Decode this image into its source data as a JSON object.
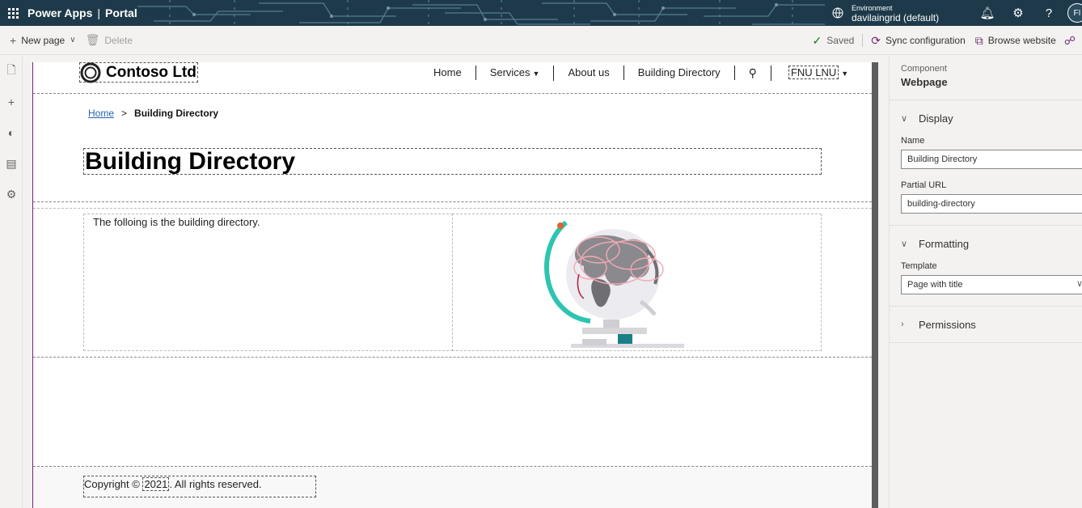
{
  "topbar": {
    "app_name": "Power Apps",
    "separator": "|",
    "section": "Portal",
    "environment_label": "Environment",
    "environment_name": "davilaingrid (default)",
    "avatar_initials": "FI"
  },
  "commandbar": {
    "new_page": "New page",
    "delete": "Delete",
    "saved": "Saved",
    "sync": "Sync configuration",
    "browse": "Browse website"
  },
  "site": {
    "logo_text": "Contoso Ltd",
    "nav": {
      "home": "Home",
      "services": "Services",
      "about": "About us",
      "directory": "Building Directory",
      "user": "FNU LNU"
    },
    "breadcrumb": {
      "home": "Home",
      "separator": ">",
      "current": "Building Directory"
    },
    "page_title": "Building Directory",
    "body_text": "The folloing is the building directory.",
    "footer": {
      "prefix": "Copyright ©",
      "year": "2021",
      "suffix": ". All rights reserved."
    }
  },
  "panel": {
    "component_label": "Component",
    "component_type": "Webpage",
    "display_header": "Display",
    "name_label": "Name",
    "name_value": "Building Directory",
    "url_label": "Partial URL",
    "url_value": "building-directory",
    "formatting_header": "Formatting",
    "template_label": "Template",
    "template_value": "Page with title",
    "permissions_header": "Permissions"
  },
  "colors": {
    "topbar_bg": "#1e3a4a",
    "canvas_accent": "#742774",
    "link": "#2266aa"
  }
}
